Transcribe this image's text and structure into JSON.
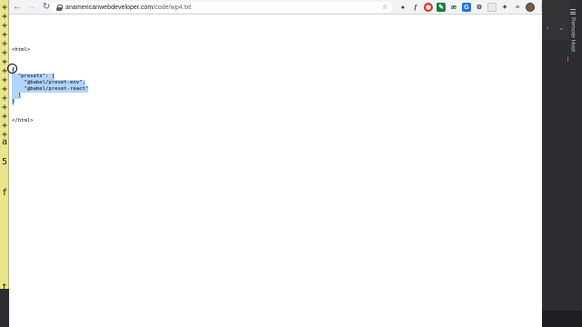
{
  "browser": {
    "url_domain": "anamericanwebdeveloper.com",
    "url_path": "/code/wp4.txt",
    "back_icon": "←",
    "forward_icon": "→",
    "reload_icon": "↻",
    "star_icon": "☆",
    "extensions": [
      "ƒ",
      "æ",
      "⚙"
    ],
    "menu_icon": "⋮"
  },
  "page": {
    "lines": [
      "<html>",
      "{",
      "  \"presets\": [",
      "    \"@babel/preset-env\",",
      "    \"@babel/preset-react\"",
      "  ]",
      "}",
      "</html>"
    ]
  },
  "ide": {
    "remote_host_label": "Remote Host",
    "gutter_chars": [
      "+",
      "+",
      "+",
      "+",
      "+",
      "+",
      "+",
      "+",
      "+",
      "+",
      "+",
      "+",
      "+",
      "+",
      "+",
      "a",
      "5",
      "f",
      "t"
    ]
  }
}
